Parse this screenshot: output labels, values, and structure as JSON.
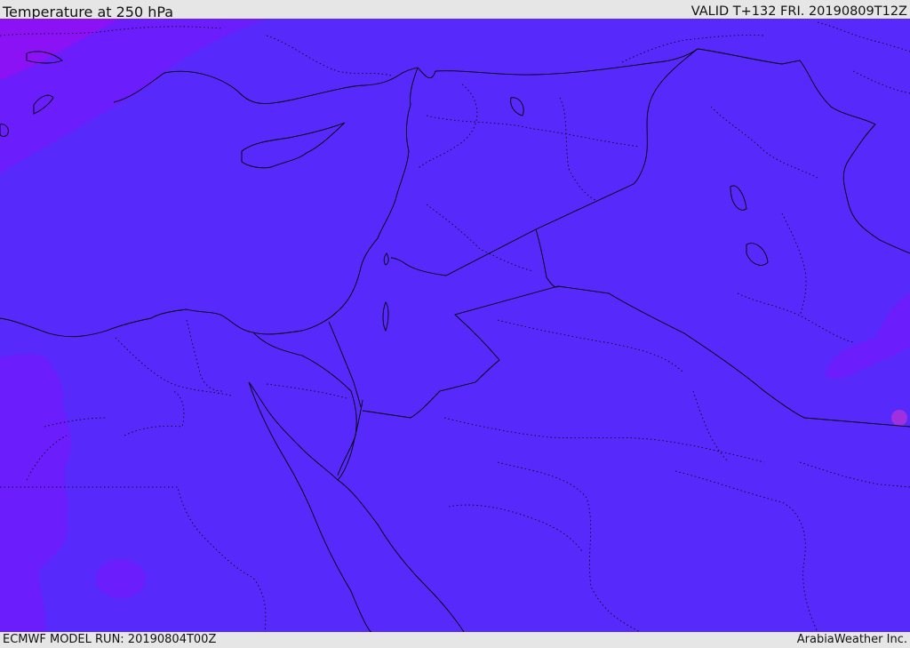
{
  "header": {
    "title": "Temperature at 250 hPa",
    "valid_label": "VALID T+132 FRI. 20190809T12Z"
  },
  "footer": {
    "model_run": "ECMWF MODEL RUN: 20190804T00Z",
    "credit": "ArabiaWeather Inc."
  },
  "map": {
    "field": "temperature_250hPa",
    "colors": {
      "dominant_fill": "#5829fb",
      "colder_fill": "#6b1dfb",
      "coldest_fill": "#8a12f5",
      "warm_spot": "#d936c8",
      "border_line": "#000000"
    }
  }
}
